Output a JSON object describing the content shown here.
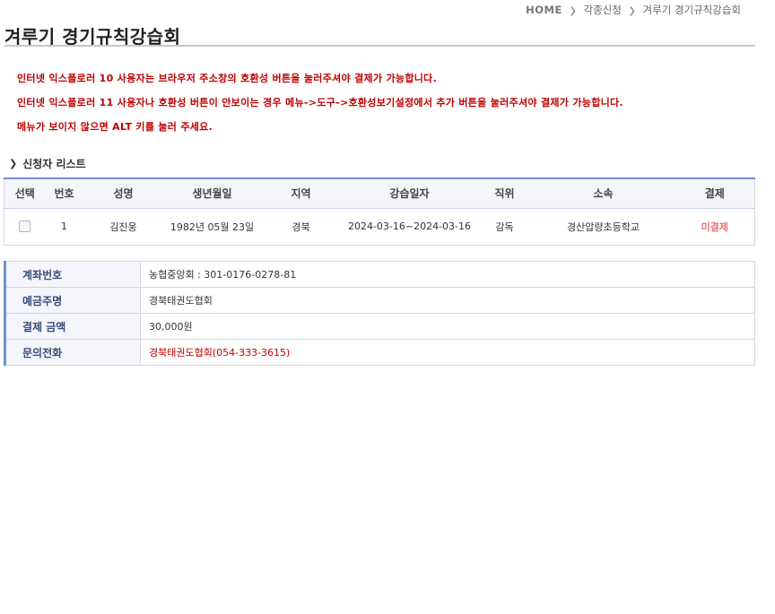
{
  "breadcrumb": {
    "home": "HOME",
    "level1": "각종신청",
    "level2": "겨루기 경기규칙강습회"
  },
  "page": {
    "title": "겨루기 경기규칙강습회"
  },
  "notices": [
    "인터넷 익스플로러 10 사용자는 브라우저 주소창의 호환성 버튼을 눌러주셔야 결제가 가능합니다.",
    "인터넷 익스플로러 11 사용자나 호환성 버튼이 안보이는 경우 메뉴->도구->호환성보기설정에서 추가 버튼을 눌러주셔야 결제가 가능합니다.",
    "메뉴가 보이지 않으면 ALT 키를 눌러 주세요."
  ],
  "applicants": {
    "section_title": "신청자 리스트",
    "headers": {
      "select": "선택",
      "number": "번호",
      "name": "성명",
      "birth": "생년월일",
      "region": "지역",
      "dates": "강습일자",
      "position": "직위",
      "affiliation": "소속",
      "payment": "결제"
    },
    "rows": [
      {
        "number": "1",
        "name": "김진웅",
        "birth": "1982년 05월 23일",
        "region": "경북",
        "dates": "2024-03-16~2024-03-16",
        "position": "감독",
        "affiliation": "경산압량초등학교",
        "payment": "미결제"
      }
    ]
  },
  "payment_info": {
    "account_label": "계좌번호",
    "account_value": "농협중앙회 : 301-0176-0278-81",
    "holder_label": "예금주명",
    "holder_value": "경북태권도협회",
    "amount_label": "결제 금액",
    "amount_value": "30,000원",
    "contact_label": "문의전화",
    "contact_value": "경북태권도협회(054-333-3615)"
  },
  "colors": {
    "notice": "#c00000",
    "accent": "#6f8fd6",
    "unpaid": "#e8737a"
  }
}
